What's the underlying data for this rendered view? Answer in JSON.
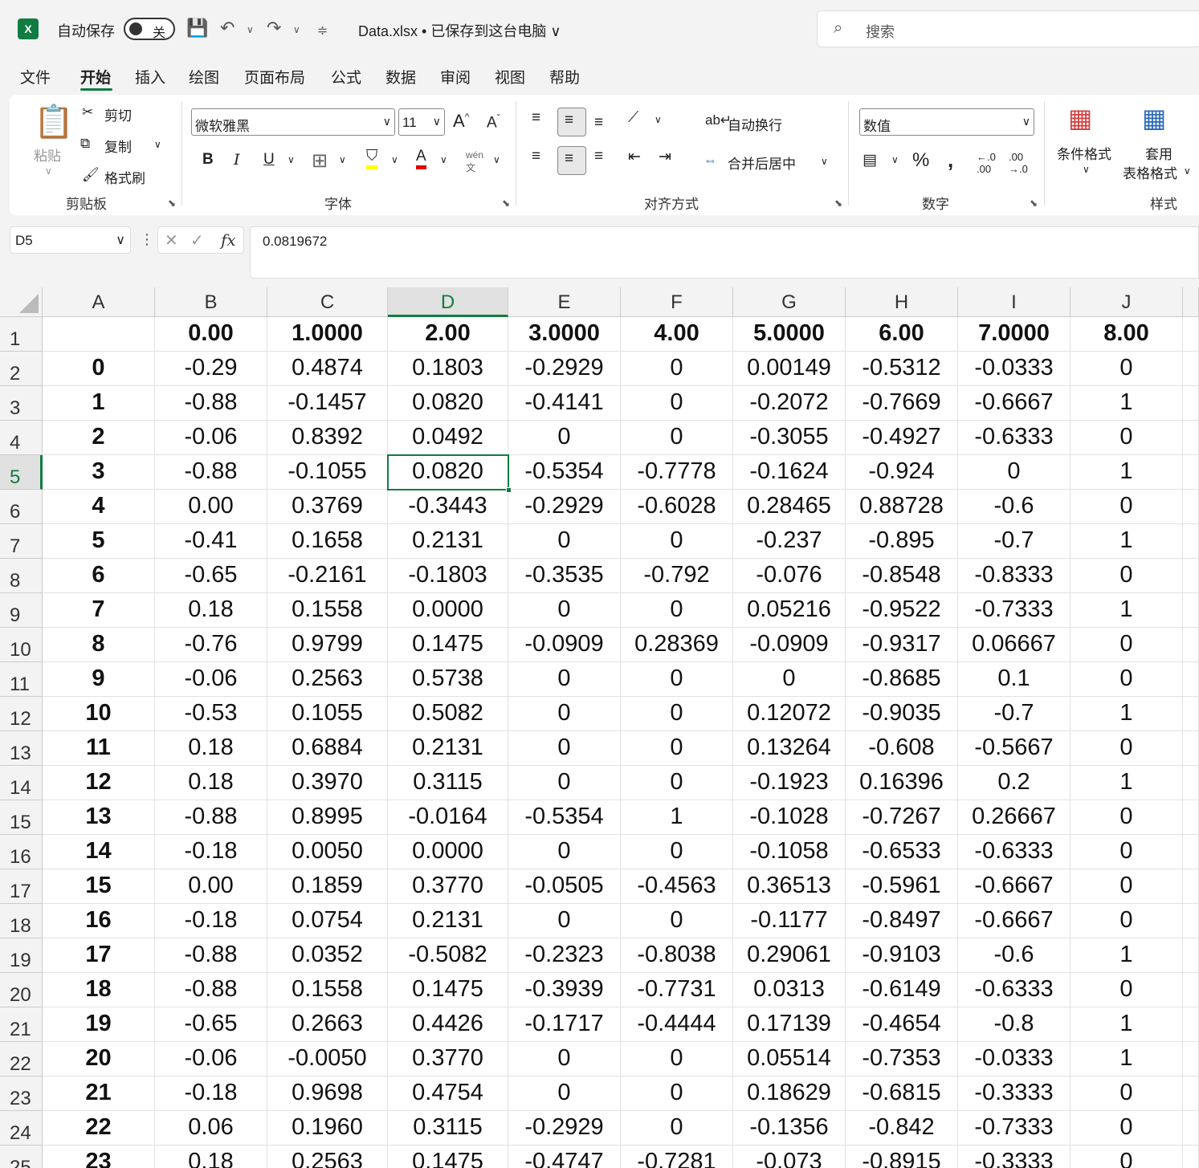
{
  "titlebar": {
    "app_icon": "X",
    "autosave_label": "自动保存",
    "autosave_state": "关",
    "doc_title": "Data.xlsx • 已保存到这台电脑 ∨",
    "search_placeholder": "搜索"
  },
  "menu": [
    "文件",
    "开始",
    "插入",
    "绘图",
    "页面布局",
    "公式",
    "数据",
    "审阅",
    "视图",
    "帮助"
  ],
  "ribbon": {
    "clipboard": {
      "paste": "粘贴",
      "cut": "剪切",
      "copy": "复制",
      "format_painter": "格式刷",
      "label": "剪贴板"
    },
    "font": {
      "name": "微软雅黑",
      "size": "11",
      "label": "字体"
    },
    "alignment": {
      "wrap": "自动换行",
      "merge": "合并后居中",
      "label": "对齐方式"
    },
    "number": {
      "format": "数值",
      "label": "数字"
    },
    "styles": {
      "conditional": "条件格式",
      "table1": "套用",
      "table2": "表格格式",
      "label": "样式"
    }
  },
  "formula_bar": {
    "name_box": "D5",
    "fx": "fx",
    "value": "0.0819672"
  },
  "sheet": {
    "columns": [
      "A",
      "B",
      "C",
      "D",
      "E",
      "F",
      "G",
      "H",
      "I",
      "J"
    ],
    "selected_col": "D",
    "selected_row": "5",
    "rows": [
      [
        "1",
        "",
        "0.00",
        "1.0000",
        "2.00",
        "3.0000",
        "4.00",
        "5.0000",
        "6.00",
        "7.0000",
        "8.00"
      ],
      [
        "2",
        "0",
        "-0.29",
        "0.4874",
        "0.1803",
        "-0.2929",
        "0",
        "0.00149",
        "-0.5312",
        "-0.0333",
        "0"
      ],
      [
        "3",
        "1",
        "-0.88",
        "-0.1457",
        "0.0820",
        "-0.4141",
        "0",
        "-0.2072",
        "-0.7669",
        "-0.6667",
        "1"
      ],
      [
        "4",
        "2",
        "-0.06",
        "0.8392",
        "0.0492",
        "0",
        "0",
        "-0.3055",
        "-0.4927",
        "-0.6333",
        "0"
      ],
      [
        "5",
        "3",
        "-0.88",
        "-0.1055",
        "0.0820",
        "-0.5354",
        "-0.7778",
        "-0.1624",
        "-0.924",
        "0",
        "1"
      ],
      [
        "6",
        "4",
        "0.00",
        "0.3769",
        "-0.3443",
        "-0.2929",
        "-0.6028",
        "0.28465",
        "0.88728",
        "-0.6",
        "0"
      ],
      [
        "7",
        "5",
        "-0.41",
        "0.1658",
        "0.2131",
        "0",
        "0",
        "-0.237",
        "-0.895",
        "-0.7",
        "1"
      ],
      [
        "8",
        "6",
        "-0.65",
        "-0.2161",
        "-0.1803",
        "-0.3535",
        "-0.792",
        "-0.076",
        "-0.8548",
        "-0.8333",
        "0"
      ],
      [
        "9",
        "7",
        "0.18",
        "0.1558",
        "0.0000",
        "0",
        "0",
        "0.05216",
        "-0.9522",
        "-0.7333",
        "1"
      ],
      [
        "10",
        "8",
        "-0.76",
        "0.9799",
        "0.1475",
        "-0.0909",
        "0.28369",
        "-0.0909",
        "-0.9317",
        "0.06667",
        "0"
      ],
      [
        "11",
        "9",
        "-0.06",
        "0.2563",
        "0.5738",
        "0",
        "0",
        "0",
        "-0.8685",
        "0.1",
        "0"
      ],
      [
        "12",
        "10",
        "-0.53",
        "0.1055",
        "0.5082",
        "0",
        "0",
        "0.12072",
        "-0.9035",
        "-0.7",
        "1"
      ],
      [
        "13",
        "11",
        "0.18",
        "0.6884",
        "0.2131",
        "0",
        "0",
        "0.13264",
        "-0.608",
        "-0.5667",
        "0"
      ],
      [
        "14",
        "12",
        "0.18",
        "0.3970",
        "0.3115",
        "0",
        "0",
        "-0.1923",
        "0.16396",
        "0.2",
        "1"
      ],
      [
        "15",
        "13",
        "-0.88",
        "0.8995",
        "-0.0164",
        "-0.5354",
        "1",
        "-0.1028",
        "-0.7267",
        "0.26667",
        "0"
      ],
      [
        "16",
        "14",
        "-0.18",
        "0.0050",
        "0.0000",
        "0",
        "0",
        "-0.1058",
        "-0.6533",
        "-0.6333",
        "0"
      ],
      [
        "17",
        "15",
        "0.00",
        "0.1859",
        "0.3770",
        "-0.0505",
        "-0.4563",
        "0.36513",
        "-0.5961",
        "-0.6667",
        "0"
      ],
      [
        "18",
        "16",
        "-0.18",
        "0.0754",
        "0.2131",
        "0",
        "0",
        "-0.1177",
        "-0.8497",
        "-0.6667",
        "0"
      ],
      [
        "19",
        "17",
        "-0.88",
        "0.0352",
        "-0.5082",
        "-0.2323",
        "-0.8038",
        "0.29061",
        "-0.9103",
        "-0.6",
        "1"
      ],
      [
        "20",
        "18",
        "-0.88",
        "0.1558",
        "0.1475",
        "-0.3939",
        "-0.7731",
        "0.0313",
        "-0.6149",
        "-0.6333",
        "0"
      ],
      [
        "21",
        "19",
        "-0.65",
        "0.2663",
        "0.4426",
        "-0.1717",
        "-0.4444",
        "0.17139",
        "-0.4654",
        "-0.8",
        "1"
      ],
      [
        "22",
        "20",
        "-0.06",
        "-0.0050",
        "0.3770",
        "0",
        "0",
        "0.05514",
        "-0.7353",
        "-0.0333",
        "1"
      ],
      [
        "23",
        "21",
        "-0.18",
        "0.9698",
        "0.4754",
        "0",
        "0",
        "0.18629",
        "-0.6815",
        "-0.3333",
        "0"
      ],
      [
        "24",
        "22",
        "0.06",
        "0.1960",
        "0.3115",
        "-0.2929",
        "0",
        "-0.1356",
        "-0.842",
        "-0.7333",
        "0"
      ],
      [
        "25",
        "23",
        "0.18",
        "0.2563",
        "0.1475",
        "-0.4747",
        "-0.7281",
        "-0.073",
        "-0.8915",
        "-0.3333",
        "0"
      ]
    ]
  }
}
